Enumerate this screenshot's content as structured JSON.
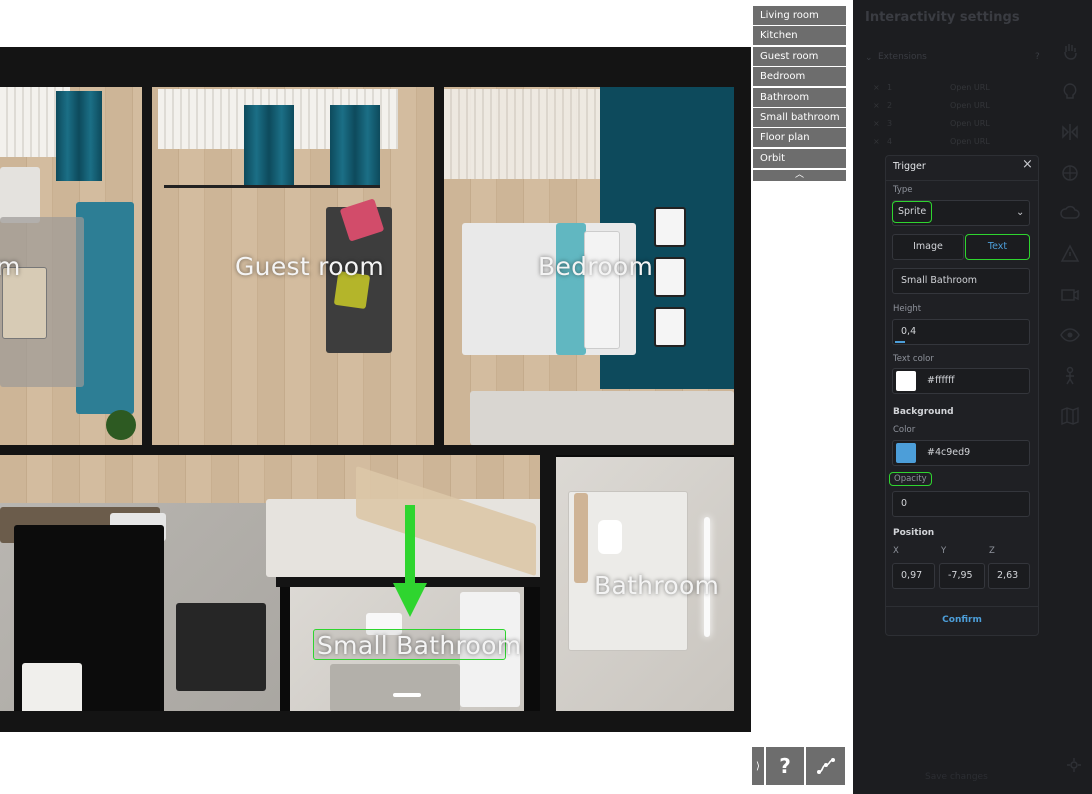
{
  "plan": {
    "labels": {
      "living_room": "m",
      "guest_room": "Guest room",
      "bedroom": "Bedroom",
      "bathroom": "Bathroom",
      "small_bathroom": "Small Bathroom"
    }
  },
  "view_menu": {
    "items": [
      {
        "label": "Living room"
      },
      {
        "label": "Kitchen"
      },
      {
        "label": "Guest room"
      },
      {
        "label": "Bedroom"
      },
      {
        "label": "Bathroom"
      },
      {
        "label": "Small bathroom"
      },
      {
        "label": "Floor plan"
      },
      {
        "label": "Orbit"
      }
    ],
    "collapse_glyph": "︿"
  },
  "controls": {
    "expand_glyph": "⟩",
    "help_label": "?"
  },
  "settings": {
    "title": "Interactivity settings",
    "extensions_label": "Extensions",
    "extensions_help": "?",
    "extensions": [
      {
        "name": "1",
        "action": "Open URL"
      },
      {
        "name": "2",
        "action": "Open URL"
      },
      {
        "name": "3",
        "action": "Open URL"
      },
      {
        "name": "4",
        "action": "Open URL"
      }
    ],
    "save_label": "Save changes"
  },
  "trigger": {
    "title": "Trigger",
    "close_glyph": "×",
    "type_label": "Type",
    "type_value": "Sprite",
    "mode_options": [
      "Image",
      "Text"
    ],
    "active_mode": "Text",
    "text_value": "Small Bathroom",
    "height_label": "Height",
    "height_value": "0,4",
    "text_color_label": "Text color",
    "text_color_value": "#ffffff",
    "background_label": "Background",
    "color_label": "Color",
    "color_value": "#4c9ed9",
    "opacity_label": "Opacity",
    "opacity_value": "0",
    "position_label": "Position",
    "axes": [
      {
        "axis": "X",
        "value": "0,97"
      },
      {
        "axis": "Y",
        "value": "-7,95"
      },
      {
        "axis": "Z",
        "value": "2,63"
      }
    ],
    "confirm_label": "Confirm"
  },
  "colors": {
    "highlight": "#2fd52f",
    "accent": "#4c9ed9",
    "teal": "#0d4a5c",
    "menu_bg": "#6d6d6d"
  }
}
